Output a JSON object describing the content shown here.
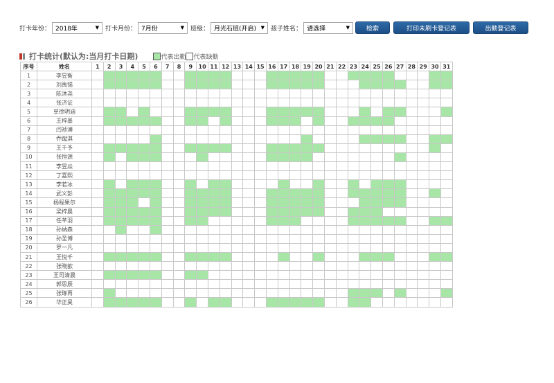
{
  "filters": {
    "year_label": "打卡年份：",
    "year_value": "2018年",
    "month_label": "打卡月份：",
    "month_value": "7月份",
    "class_label": "班级：",
    "class_value": "月光石班(开启)",
    "child_label": "孩子姓名：",
    "child_value": "请选择",
    "search_button": "检索",
    "print_button": "打印未刷卡登记表",
    "attendance_button": "出勤登记表"
  },
  "section": {
    "title": "打卡统计(默认为:当月打卡日期)",
    "legend_present": "代表出勤",
    "legend_absent": "代表缺勤"
  },
  "colors": {
    "present": "#a8e6a8",
    "button": "#1d4f86",
    "title_mark": "#c0392b"
  },
  "table": {
    "index_header": "序号",
    "name_header": "姓名",
    "days": [
      "1",
      "2",
      "3",
      "4",
      "5",
      "6",
      "7",
      "8",
      "9",
      "10",
      "11",
      "12",
      "13",
      "14",
      "15",
      "16",
      "17",
      "18",
      "19",
      "20",
      "21",
      "22",
      "23",
      "24",
      "25",
      "26",
      "27",
      "28",
      "29",
      "30",
      "31"
    ],
    "rows": [
      {
        "no": "1",
        "name": "李昱衡",
        "att": "0111110011110001111100111100011"
      },
      {
        "no": "2",
        "name": "刘禹锡",
        "att": "0111110011110001111100011110011"
      },
      {
        "no": "3",
        "name": "陈沐尧",
        "att": "0000000000000000000000000000000"
      },
      {
        "no": "4",
        "name": "张济证",
        "att": "0000000000000000000000000000000"
      },
      {
        "no": "5",
        "name": "单徐明涵",
        "att": "0110100011110001111100010110001"
      },
      {
        "no": "6",
        "name": "王梓墨",
        "att": "0111110011010001110100111100000"
      },
      {
        "no": "7",
        "name": "闫祯溥",
        "att": "0000000000000000000000000000000"
      },
      {
        "no": "8",
        "name": "乔蹴淇",
        "att": "0000010000000000001000011110011"
      },
      {
        "no": "9",
        "name": "王千予",
        "att": "0111110011110001111100000000010"
      },
      {
        "no": "10",
        "name": "张恒源",
        "att": "0101110001000001111000000010000"
      },
      {
        "no": "11",
        "name": "李昱焱",
        "att": "0000000000000000000000000000000"
      },
      {
        "no": "12",
        "name": "丁嘉熙",
        "att": "0000000000000000000000000000000"
      },
      {
        "no": "13",
        "name": "李若冰",
        "att": "0101110010110000100100101110000"
      },
      {
        "no": "14",
        "name": "武义彭",
        "att": "0111110011110001111100111110010"
      },
      {
        "no": "15",
        "name": "杨程果尔",
        "att": "0111010011110001111100011110000"
      },
      {
        "no": "16",
        "name": "梁梓晨",
        "att": "0111110011110001111100111000000"
      },
      {
        "no": "17",
        "name": "任芊羽",
        "att": "0111110011000001110000111110011"
      },
      {
        "no": "18",
        "name": "孙纳森",
        "att": "0010010000000000000000000000000"
      },
      {
        "no": "19",
        "name": "孙圣博",
        "att": "0000000000000000000000000000000"
      },
      {
        "no": "20",
        "name": "罗一凡",
        "att": "0000000000000000000000000000000"
      },
      {
        "no": "21",
        "name": "王悦千",
        "att": "0111110011110000100100011100011"
      },
      {
        "no": "22",
        "name": "张晓歆",
        "att": "0000000000000000000000000000000"
      },
      {
        "no": "23",
        "name": "王司清晨",
        "att": "0111110011000000000000000000000"
      },
      {
        "no": "24",
        "name": "郭思辰",
        "att": "0000000000000000000000000000000"
      },
      {
        "no": "25",
        "name": "张琢再",
        "att": "0100000000000000000000111010001"
      },
      {
        "no": "26",
        "name": "华正昊",
        "att": "0111110010110001111100110000000"
      }
    ]
  }
}
